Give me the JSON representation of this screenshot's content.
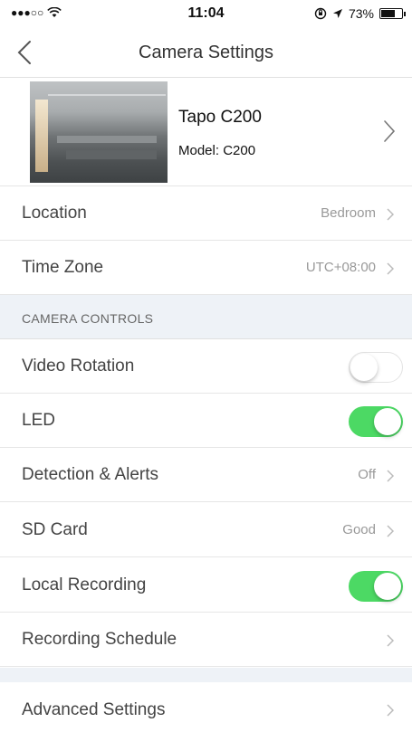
{
  "status_bar": {
    "signal": "●●●○○",
    "wifi_icon": "wifi-icon",
    "time": "11:04",
    "battery_percent": "73%",
    "battery_level": 0.73
  },
  "nav": {
    "title": "Camera Settings",
    "back_icon": "chevron-left-icon"
  },
  "device": {
    "name": "Tapo C200",
    "model": "Model: C200"
  },
  "rows": {
    "location": {
      "label": "Location",
      "value": "Bedroom"
    },
    "time_zone": {
      "label": "Time Zone",
      "value": "UTC+08:00"
    }
  },
  "camera_controls": {
    "header": "CAMERA CONTROLS",
    "video_rotation": {
      "label": "Video Rotation",
      "enabled": false
    },
    "led": {
      "label": "LED",
      "enabled": true
    },
    "detection_alerts": {
      "label": "Detection & Alerts",
      "value": "Off"
    },
    "sd_card": {
      "label": "SD Card",
      "value": "Good"
    },
    "local_recording": {
      "label": "Local Recording",
      "enabled": true
    },
    "recording_schedule": {
      "label": "Recording Schedule"
    }
  },
  "advanced": {
    "label": "Advanced Settings"
  },
  "colors": {
    "toggle_on": "#4cd964",
    "section_bg": "#eef2f7",
    "value_text": "#999999"
  }
}
